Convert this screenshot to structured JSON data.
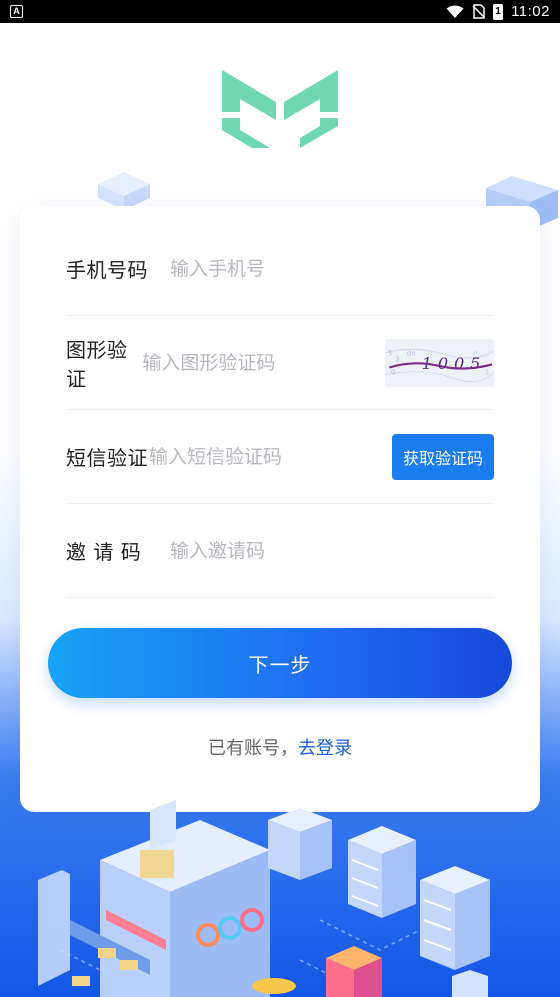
{
  "status_bar": {
    "app_badge": "A",
    "battery_level": "1",
    "time": "11:02"
  },
  "form": {
    "phone": {
      "label": "手机号码",
      "placeholder": "输入手机号"
    },
    "captcha": {
      "label": "图形验证",
      "placeholder": "输入图形验证码",
      "image_text": "1005"
    },
    "sms": {
      "label": "短信验证",
      "placeholder": "输入短信验证码",
      "button_label": "获取验证码"
    },
    "invite": {
      "label": "邀 请 码",
      "placeholder": "输入邀请码"
    }
  },
  "next_button_label": "下一步",
  "login_prompt": {
    "text": "已有账号，",
    "link_text": "去登录"
  },
  "colors": {
    "logo_green": "#6fd8b2",
    "primary_blue": "#1b7cf0",
    "link_blue": "#1d5fd6"
  }
}
